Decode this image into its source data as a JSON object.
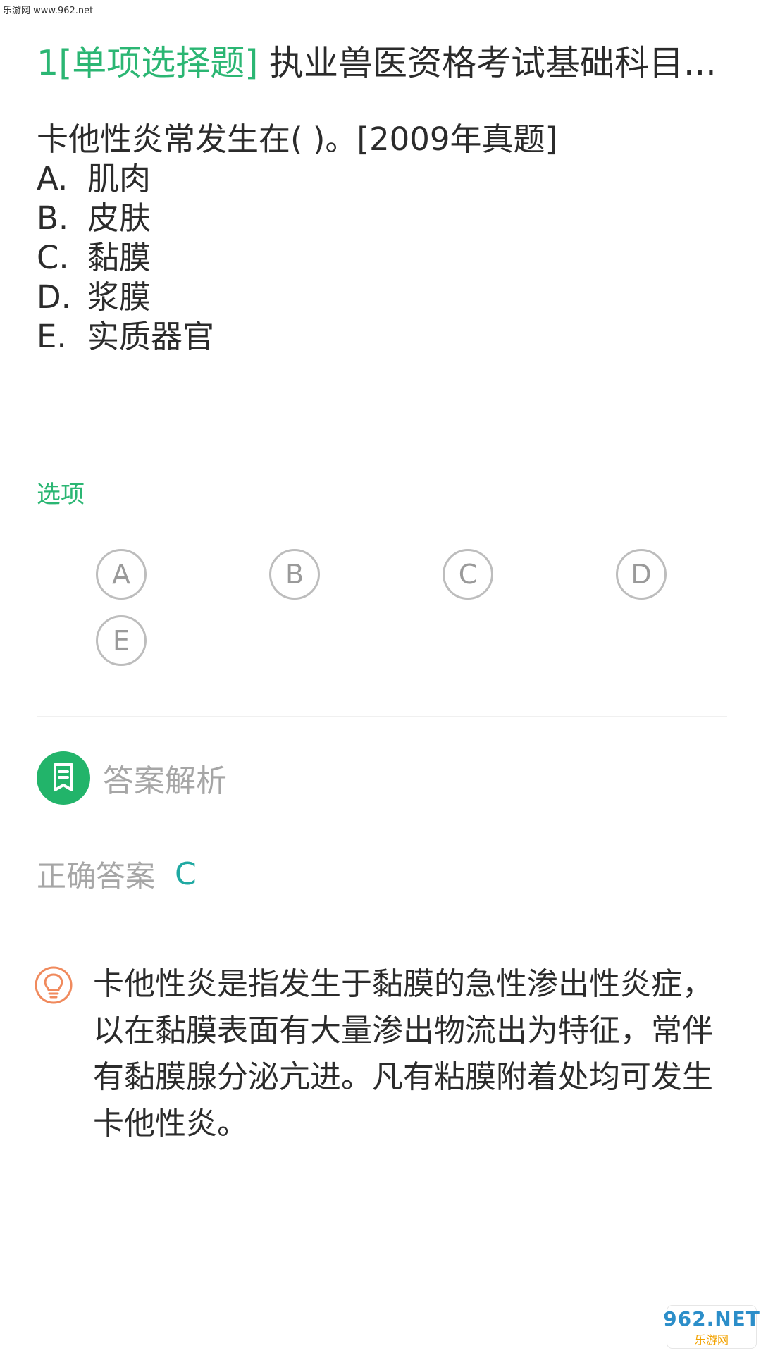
{
  "watermark_top": "乐游网 www.962.net",
  "title": {
    "number": "1",
    "type": "[单项选择题]",
    "text": " 执业兽医资格考试基础科目..."
  },
  "question": {
    "stem": "卡他性炎常发生在( )。[2009年真题]",
    "options": [
      {
        "letter": "A.",
        "text": "肌肉"
      },
      {
        "letter": "B.",
        "text": "皮肤"
      },
      {
        "letter": "C.",
        "text": "黏膜"
      },
      {
        "letter": "D.",
        "text": "浆膜"
      },
      {
        "letter": "E.",
        "text": "实质器官"
      }
    ]
  },
  "options_section": {
    "label": "选项",
    "choices": [
      "A",
      "B",
      "C",
      "D",
      "E"
    ]
  },
  "analysis": {
    "title": "答案解析",
    "correct_label": "正确答案",
    "correct_value": "C",
    "explanation": "卡他性炎是指发生于黏膜的急性渗出性炎症，以在黏膜表面有大量渗出物流出为特征，常伴有黏膜腺分泌亢进。凡有粘膜附着处均可发生卡他性炎。"
  },
  "watermark_bottom": {
    "top": "962.NET",
    "bottom": "乐游网"
  },
  "colors": {
    "accent_green": "#2bb673",
    "answer_teal": "#1fa9a2",
    "muted_gray": "#a6a6a6",
    "bulb_orange": "#f08a5d"
  }
}
